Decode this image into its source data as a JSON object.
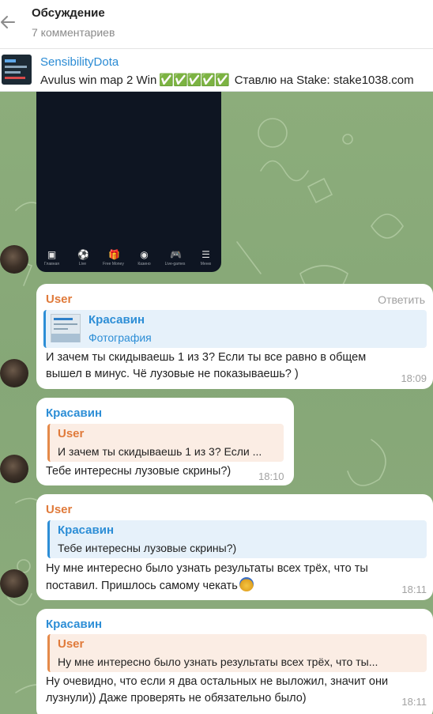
{
  "header": {
    "title": "Обсуждение",
    "subtitle": "7 комментариев",
    "back_icon": "arrow-left-icon"
  },
  "pinned": {
    "channel_name": "SensibilityDota",
    "text_before": "Avulus win map 2  Win",
    "checks": "✅✅✅✅✅",
    "text_after": "Ставлю на Stake: stake1038.com"
  },
  "photo": {
    "menu_items": [
      {
        "icon": "home-icon",
        "glyph": "▣",
        "label": "Главная"
      },
      {
        "icon": "soccer-ball-icon",
        "glyph": "⚽",
        "label": "Live"
      },
      {
        "icon": "gift-icon",
        "glyph": "🎁",
        "label": "Free Money"
      },
      {
        "icon": "casino-chip-icon",
        "glyph": "◉",
        "label": "Казино"
      },
      {
        "icon": "gamepad-icon",
        "glyph": "🎮",
        "label": "Live-games"
      },
      {
        "icon": "menu-icon",
        "glyph": "☰",
        "label": "Меню"
      }
    ]
  },
  "messages": [
    {
      "author": "User",
      "reply_action": "Ответить",
      "quote_author": "Красавин",
      "quote_text": "Фотография",
      "lines": [
        "И зачем ты скидываешь 1 из 3? Если ты все равно в общем",
        "вышел в минус. Чё лузовые не показываешь? )"
      ],
      "time": "18:09"
    },
    {
      "author": "Красавин",
      "quote_author": "User",
      "quote_text": "И зачем ты скидываешь 1 из 3? Если ...",
      "lines": [
        "Тебе интересны лузовые скрины?)"
      ],
      "time": "18:10"
    },
    {
      "author": "User",
      "quote_author": "Красавин",
      "quote_text": "Тебе интересны лузовые скрины?)",
      "lines": [
        "Ну мне интересно было узнать результаты всех трёх,  что ты",
        "поставил. Пришлось самому чекать"
      ],
      "emoji": "facepalm-emoji",
      "time": "18:11"
    },
    {
      "author": "Красавин",
      "quote_author": "User",
      "quote_text": "Ну мне интересно было узнать результаты всех трёх,  что ты...",
      "lines": [
        "Ну очевидно, что если я два остальных не выложил, значит они",
        "лузнули)) Даже проверять не обязательно было)"
      ],
      "time": "18:11"
    }
  ],
  "colors": {
    "accent_blue": "#2d8ed6",
    "accent_orange": "#e07a3a",
    "chat_background": "#88a779",
    "check_green": "#3dbb3d"
  }
}
